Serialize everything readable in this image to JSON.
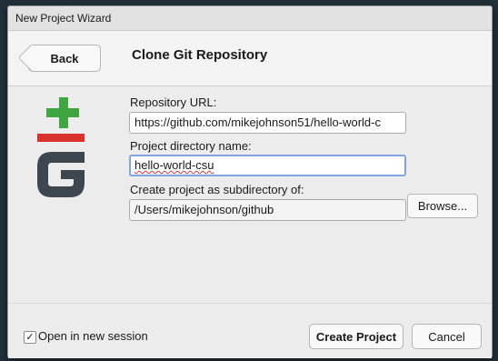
{
  "window": {
    "title": "New Project Wizard"
  },
  "header": {
    "back_label": "Back",
    "page_title": "Clone Git Repository"
  },
  "form": {
    "repo_url_label": "Repository URL:",
    "repo_url_value": "https://github.com/mikejohnson51/hello-world-c",
    "dir_name_label": "Project directory name:",
    "dir_name_value": "hello-world-csu",
    "subdir_label": "Create project as subdirectory of:",
    "subdir_value": "/Users/mikejohnson/github",
    "browse_label": "Browse..."
  },
  "footer": {
    "open_new_session_checked": true,
    "check_mark": "✓",
    "open_new_session_label": "Open in new session",
    "create_label": "Create Project",
    "cancel_label": "Cancel"
  },
  "colors": {
    "git_plus": "#3fa540",
    "git_bar": "#d9322c",
    "git_g": "#3e474f"
  }
}
